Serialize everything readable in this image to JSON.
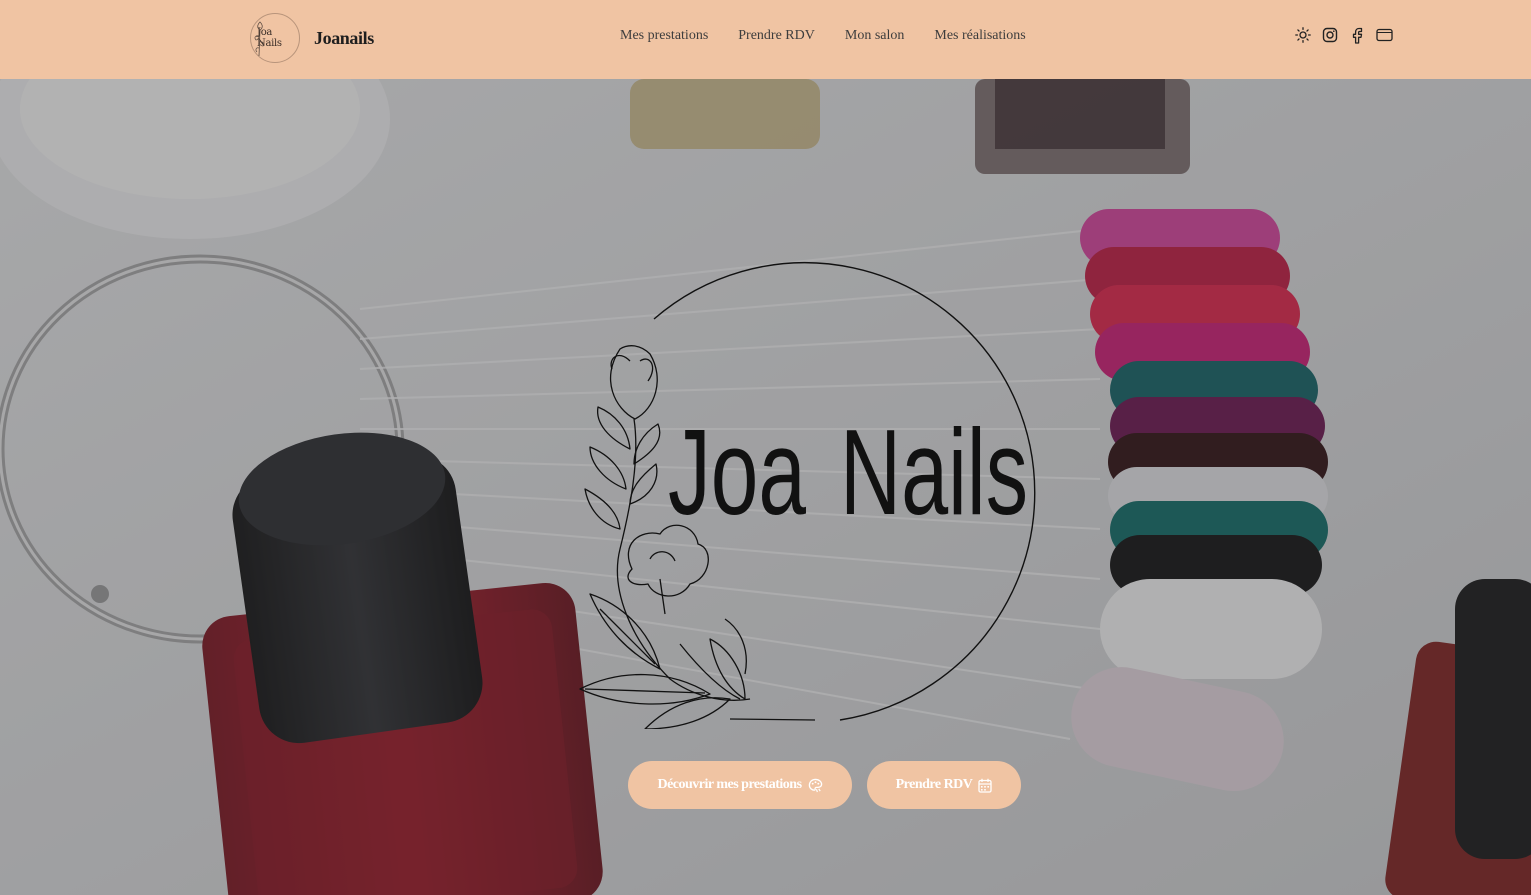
{
  "header": {
    "logo_text": "Joa Nails",
    "brand_name": "Joanails",
    "nav": [
      "Mes prestations",
      "Prendre RDV",
      "Mon salon",
      "Mes réalisations"
    ],
    "icons": [
      "sun-icon",
      "instagram-icon",
      "facebook-icon",
      "window-icon"
    ]
  },
  "hero": {
    "logo_text_left": "Joa",
    "logo_text_right": "Nails",
    "buttons": [
      {
        "label": "Découvrir mes prestations",
        "icon": "palette-icon"
      },
      {
        "label": "Prendre RDV",
        "icon": "calendar-icon"
      }
    ]
  },
  "colors": {
    "header_bg": "#f0c4a3",
    "button_bg": "#f0c4a3",
    "button_text": "#ffffff",
    "nav_text": "#3d3d3d"
  }
}
